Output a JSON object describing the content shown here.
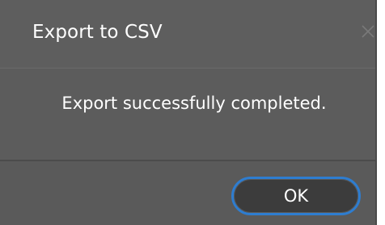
{
  "dialog": {
    "title": "Export to CSV",
    "message": "Export successfully completed.",
    "ok_label": "OK",
    "close_icon": "close-icon"
  },
  "colors": {
    "background": "#5c5c5c",
    "text": "#ffffff",
    "button_bg": "#3c3c3c",
    "button_border": "#2e7dd0"
  }
}
